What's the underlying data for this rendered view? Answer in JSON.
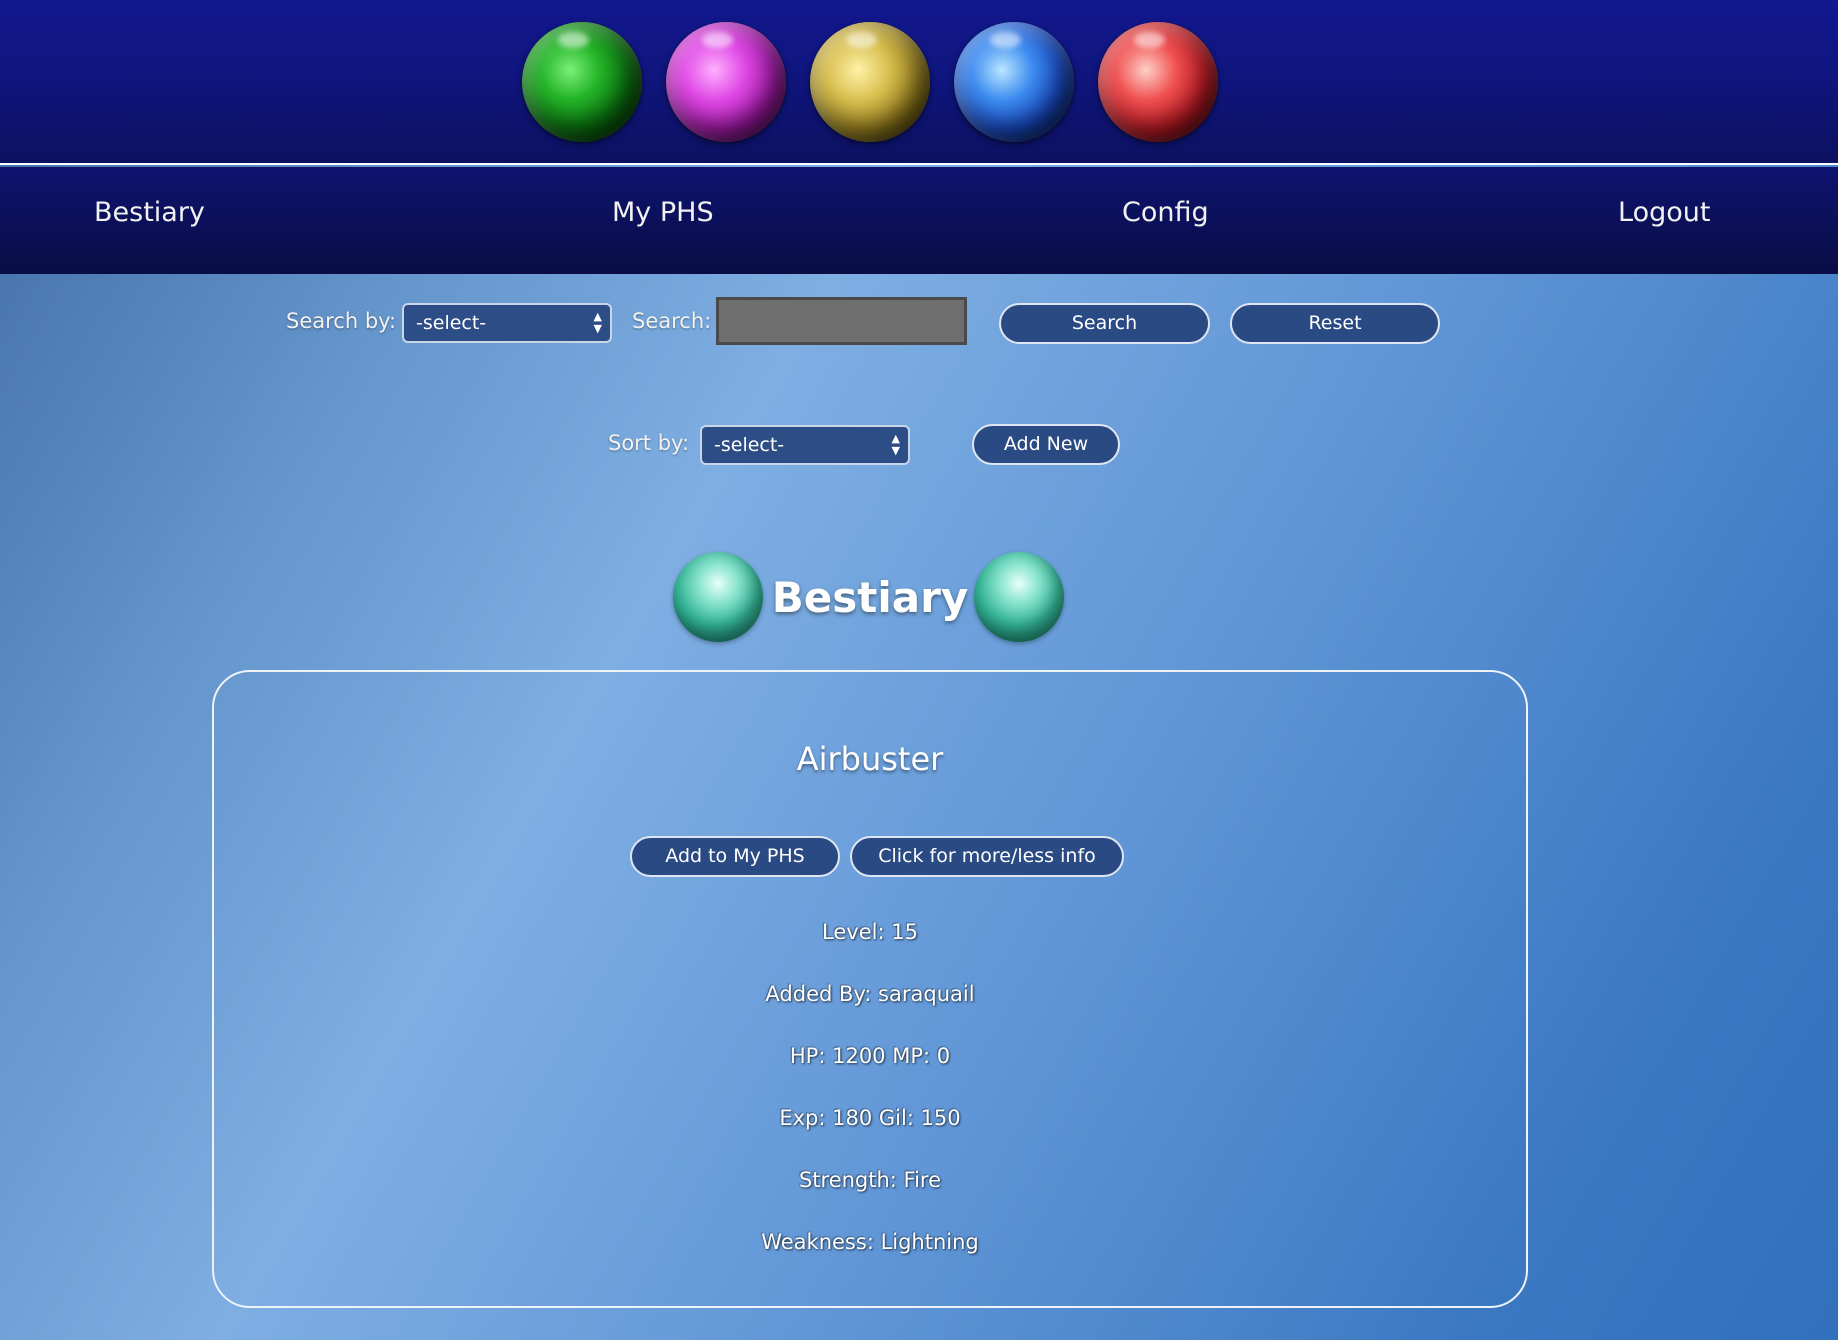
{
  "header": {
    "orbs": [
      {
        "name": "green-orb-icon",
        "color": "#1fa524"
      },
      {
        "name": "purple-orb-icon",
        "color": "#d63ad8"
      },
      {
        "name": "gold-orb-icon",
        "color": "#cbb043"
      },
      {
        "name": "blue-orb-icon",
        "color": "#2f6fe0"
      },
      {
        "name": "red-orb-icon",
        "color": "#e23c3c"
      }
    ]
  },
  "nav": {
    "bestiary": "Bestiary",
    "my_phs": "My PHS",
    "config": "Config",
    "logout": "Logout"
  },
  "search": {
    "search_by_label": "Search by:",
    "search_by_value": "-select-",
    "search_label": "Search:",
    "search_value": "",
    "search_button": "Search",
    "reset_button": "Reset"
  },
  "sort": {
    "sort_by_label": "Sort by:",
    "sort_by_value": "-select-",
    "add_new_button": "Add New"
  },
  "page_title": "Bestiary",
  "monster": {
    "name": "Airbuster",
    "add_button": "Add to My PHS",
    "toggle_button": "Click for more/less info",
    "level": "Level: 15",
    "added_by": "Added By: saraquail",
    "hp_mp": "HP: 1200 MP: 0",
    "exp_gil": "Exp: 180 Gil: 150",
    "strength": "Strength: Fire",
    "weakness": "Weakness: Lightning"
  },
  "colors": {
    "header_bg": "#12188f",
    "nav_bg": "#0b1056",
    "button_bg": "#2a4a83",
    "input_bg": "#6e6e6e",
    "teal_orb": "#35b596"
  }
}
